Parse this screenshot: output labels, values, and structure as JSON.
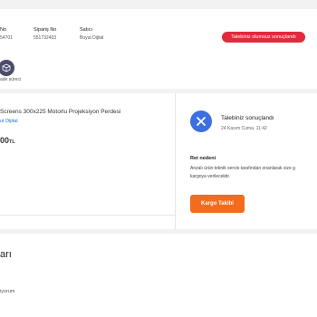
{
  "order": {
    "columns": [
      {
        "label": "No",
        "value": "54701"
      },
      {
        "label": "Sipariş No",
        "value": "551732403"
      },
      {
        "label": "Satıcı",
        "value": "Boyut Dijital"
      }
    ],
    "status_badge": "Talebiniz olumsuz sonuçlandı",
    "process_label": "ade süreci"
  },
  "product": {
    "title": "Screens 300x225 Motorlu Projeksiyon Perdesi",
    "seller": "ut Dijital",
    "price": "00",
    "currency": "TL"
  },
  "result": {
    "title": "Talebiniz sonuçlandı",
    "date": "24 Kasım Cuma, 11:42",
    "reason_heading": "Ret nedeni",
    "reason_line1": "Anzalı ürün teknik servis tarafından onanlarak size g",
    "reason_line2": "kargoya verilecektir.",
    "tracking_button": "Kargo Takibi"
  },
  "section": {
    "title": "arı",
    "text": "iyorum"
  },
  "colors": {
    "accent_orange": "#f26c1c",
    "status_red": "#e32a3c",
    "icon_blue": "#3d6fe0",
    "link_blue": "#1e72d9"
  }
}
